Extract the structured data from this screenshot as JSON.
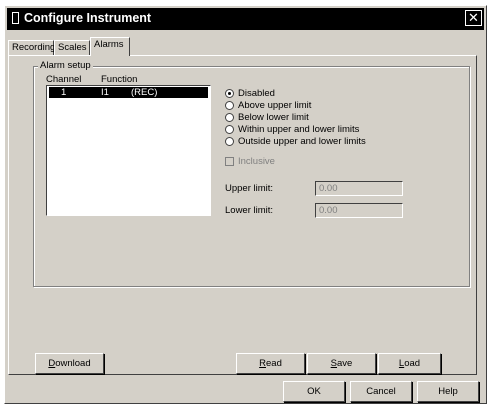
{
  "window": {
    "title": "Configure Instrument",
    "close_glyph": "✕"
  },
  "tabs": [
    "Recording",
    "Scales",
    "Alarms"
  ],
  "active_tab": "Alarms",
  "alarm_setup": {
    "group_label": "Alarm setup",
    "columns": [
      "Channel",
      "Function"
    ],
    "rows": [
      {
        "channel": "1",
        "input": "I1",
        "function": "(REC)",
        "selected": true
      }
    ],
    "options": [
      "Disabled",
      "Above upper limit",
      "Below lower limit",
      "Within upper and lower limits",
      "Outside upper and lower limits"
    ],
    "selected_option": "Disabled",
    "inclusive_label": "Inclusive",
    "upper_limit_label": "Upper limit:",
    "upper_limit_value": "0.00",
    "lower_limit_label": "Lower limit:",
    "lower_limit_value": "0.00"
  },
  "buttons": {
    "download": {
      "underline": "D",
      "rest": "ownload"
    },
    "read": {
      "underline": "R",
      "rest": "ead"
    },
    "save": {
      "underline": "S",
      "rest": "ave"
    },
    "load": {
      "underline": "L",
      "rest": "oad"
    },
    "ok": "OK",
    "cancel": "Cancel",
    "help": "Help"
  }
}
